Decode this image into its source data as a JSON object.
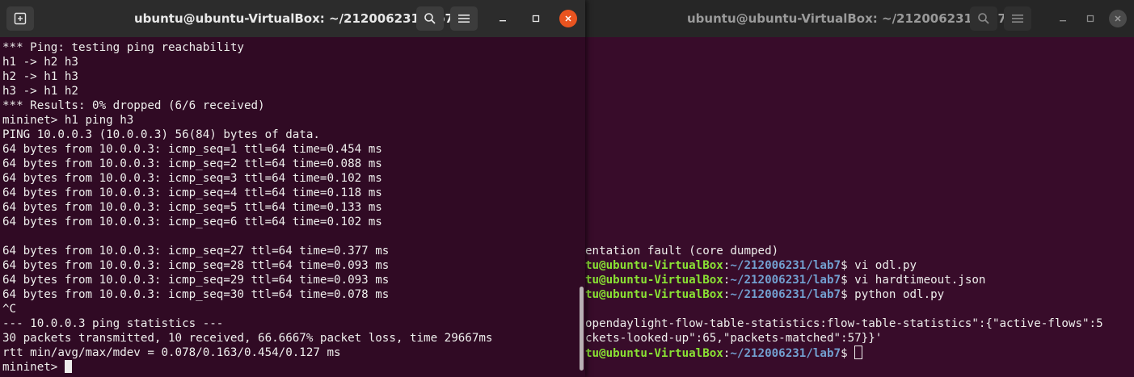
{
  "back_window": {
    "title": "ubuntu@ubuntu-VirtualBox: ~/212006231/lab7",
    "lines": [
      {
        "t": "entation fault (core dumped)"
      },
      {
        "u": "tu@ubuntu-VirtualBox",
        "p": "~/212006231/lab7",
        "c": " vi odl.py"
      },
      {
        "u": "tu@ubuntu-VirtualBox",
        "p": "~/212006231/lab7",
        "c": " vi hardtimeout.json"
      },
      {
        "u": "tu@ubuntu-VirtualBox",
        "p": "~/212006231/lab7",
        "c": " python odl.py"
      },
      {
        "t": ""
      },
      {
        "t": "opendaylight-flow-table-statistics:flow-table-statistics\":{\"active-flows\":5"
      },
      {
        "t": "ckets-looked-up\":65,\"packets-matched\":57}}'"
      },
      {
        "u": "tu@ubuntu-VirtualBox",
        "p": "~/212006231/lab7",
        "c": " ",
        "cursor": true
      }
    ]
  },
  "front_window": {
    "title": "ubuntu@ubuntu-VirtualBox: ~/212006231/lab7",
    "lines": [
      "*** Ping: testing ping reachability",
      "h1 -> h2 h3",
      "h2 -> h1 h3",
      "h3 -> h1 h2",
      "*** Results: 0% dropped (6/6 received)",
      "mininet> h1 ping h3",
      "PING 10.0.0.3 (10.0.0.3) 56(84) bytes of data.",
      "64 bytes from 10.0.0.3: icmp_seq=1 ttl=64 time=0.454 ms",
      "64 bytes from 10.0.0.3: icmp_seq=2 ttl=64 time=0.088 ms",
      "64 bytes from 10.0.0.3: icmp_seq=3 ttl=64 time=0.102 ms",
      "64 bytes from 10.0.0.3: icmp_seq=4 ttl=64 time=0.118 ms",
      "64 bytes from 10.0.0.3: icmp_seq=5 ttl=64 time=0.133 ms",
      "64 bytes from 10.0.0.3: icmp_seq=6 ttl=64 time=0.102 ms",
      "",
      "64 bytes from 10.0.0.3: icmp_seq=27 ttl=64 time=0.377 ms",
      "64 bytes from 10.0.0.3: icmp_seq=28 ttl=64 time=0.093 ms",
      "64 bytes from 10.0.0.3: icmp_seq=29 ttl=64 time=0.093 ms",
      "64 bytes from 10.0.0.3: icmp_seq=30 ttl=64 time=0.078 ms",
      "^C",
      "--- 10.0.0.3 ping statistics ---",
      "30 packets transmitted, 10 received, 66.6667% packet loss, time 29667ms",
      "rtt min/avg/max/mdev = 0.078/0.163/0.454/0.127 ms",
      "mininet> "
    ]
  },
  "icons": {
    "new_tab": "new-tab-icon",
    "search": "search-icon",
    "menu": "hamburger-menu-icon",
    "minimize": "minimize-icon",
    "maximize": "maximize-icon",
    "close": "close-icon"
  },
  "colors": {
    "terminal_bg": "#300a24",
    "titlebar_bg": "#2c2c2c",
    "prompt_user": "#8ae234",
    "prompt_path": "#729fcf",
    "close_button": "#e95420"
  }
}
